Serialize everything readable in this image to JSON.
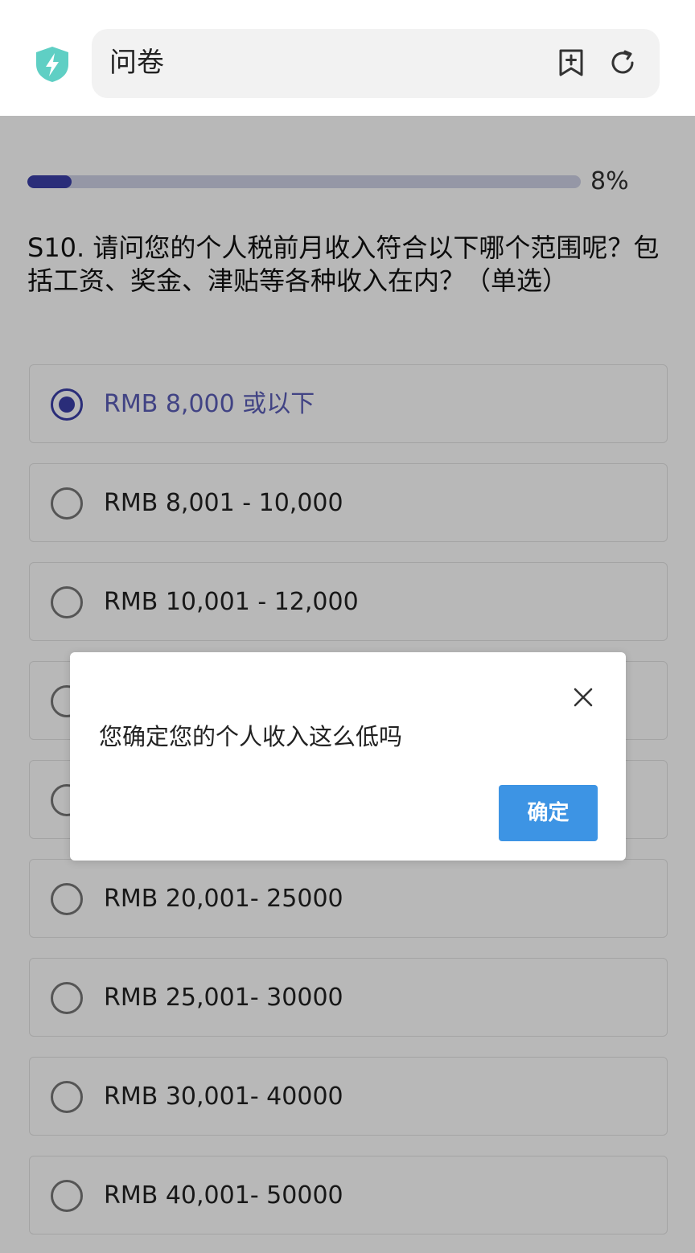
{
  "browser": {
    "title": "问卷",
    "icons": {
      "security": "shield-lightning-icon",
      "bookmark": "bookmark-add-icon",
      "reload": "reload-icon"
    },
    "shield_color": "#5fcfc4"
  },
  "survey": {
    "progress_percent": 8,
    "progress_label": "8%",
    "question": "S10. 请问您的个人税前月收入符合以下哪个范围呢？包括工资、奖金、津贴等各种收入在内？（单选）",
    "selected_index": 0,
    "options": [
      {
        "label": "RMB 8,000 或以下"
      },
      {
        "label": "RMB 8,001 - 10,000"
      },
      {
        "label": "RMB 10,001 - 12,000"
      },
      {
        "label": ""
      },
      {
        "label": ""
      },
      {
        "label": "RMB 20,001- 25000"
      },
      {
        "label": "RMB 25,001- 30000"
      },
      {
        "label": "RMB 30,001- 40000"
      },
      {
        "label": "RMB 40,001- 50000"
      }
    ],
    "accent_color": "#3b3fa8"
  },
  "dialog": {
    "message": "您确定您的个人收入这么低吗",
    "confirm_label": "确定",
    "close_icon": "close-icon",
    "confirm_color": "#3d94e4"
  }
}
